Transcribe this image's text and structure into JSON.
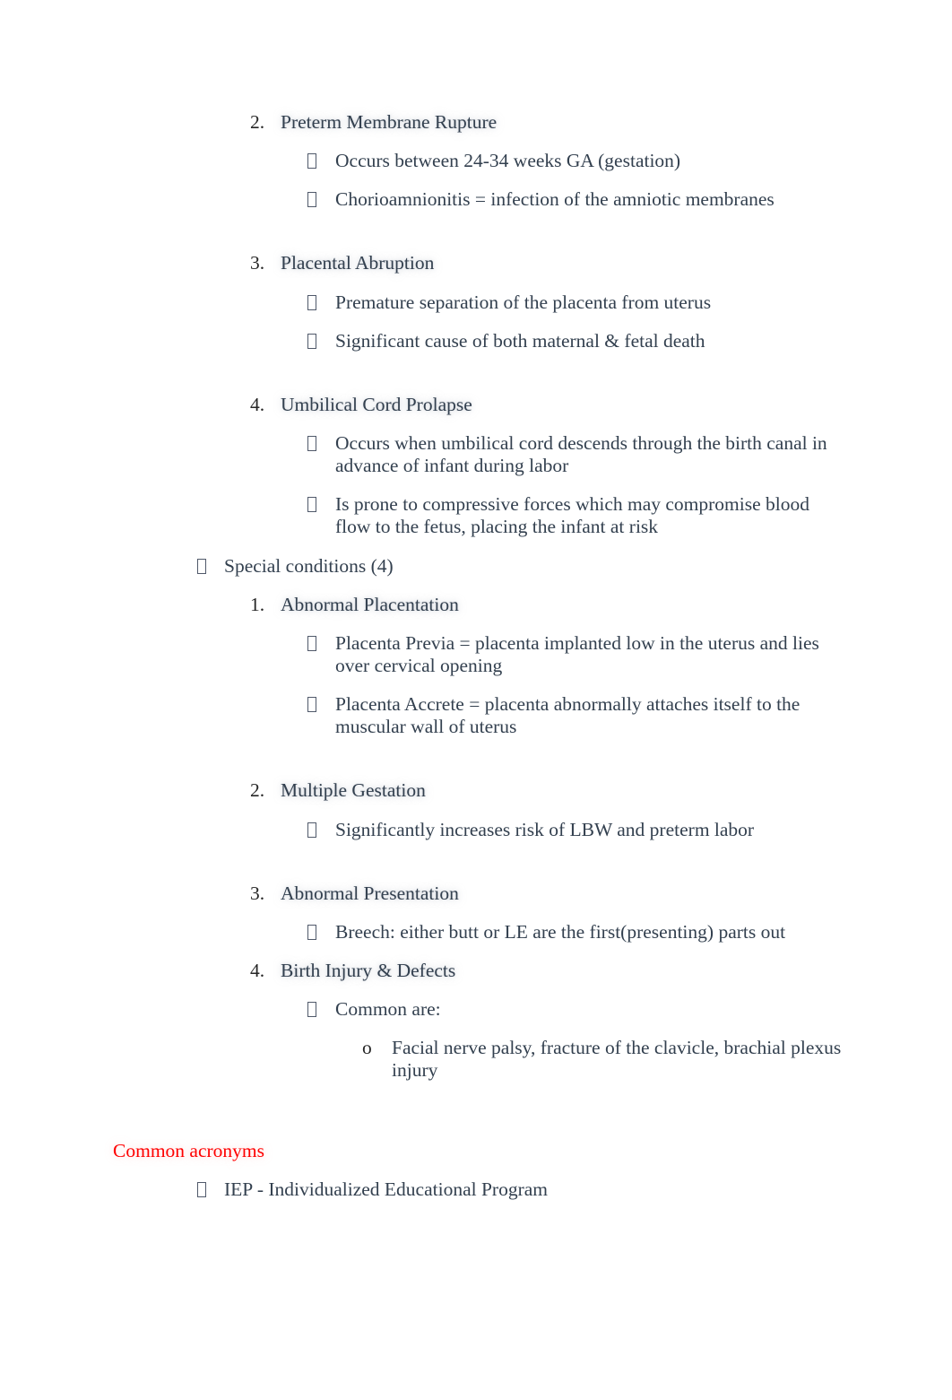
{
  "document": {
    "bullet_glyph": "tofu-box",
    "text_color": "#33404f",
    "marker_color": "#262626",
    "accent_color": "#ff0000",
    "background": "#ffffff"
  },
  "blocks": [
    {
      "id": "preterm-membrane-rupture",
      "level": 2,
      "marker": "2.",
      "text": "Preterm Membrane Rupture",
      "halo": true,
      "children": [
        {
          "id": "pmr-ga",
          "level": 3,
          "marker": "tofu",
          "text": "Occurs between 24-34 weeks GA (gestation)"
        },
        {
          "id": "pmr-chorioamnionitis",
          "level": 3,
          "marker": "tofu",
          "text": "Chorioamnionitis = infection of the amniotic membranes"
        }
      ]
    },
    {
      "id": "placental-abruption",
      "level": 2,
      "marker": "3.",
      "text": "Placental Abruption",
      "halo": true,
      "children": [
        {
          "id": "pa-separation",
          "level": 3,
          "marker": "tofu",
          "text": "Premature separation of the placenta from uterus"
        },
        {
          "id": "pa-death",
          "level": 3,
          "marker": "tofu",
          "text": "Significant cause of both maternal & fetal death"
        }
      ]
    },
    {
      "id": "umbilical-cord-prolapse",
      "level": 2,
      "marker": "4.",
      "text": "Umbilical Cord Prolapse",
      "halo": true,
      "children": [
        {
          "id": "ucp-descends",
          "level": 3,
          "marker": "tofu",
          "text": "Occurs when umbilical cord descends through the birth canal in advance of infant during labor"
        },
        {
          "id": "ucp-compressive",
          "level": 3,
          "marker": "tofu",
          "text": "Is prone to compressive forces which may compromise blood flow to the fetus, placing the infant at risk"
        }
      ]
    },
    {
      "id": "special-conditions",
      "level": 1,
      "marker": "tofu",
      "text": "Special conditions (4)",
      "halo": false,
      "children": [
        {
          "id": "abnormal-placentation",
          "level": 2,
          "marker": "1.",
          "text": "Abnormal Placentation",
          "halo": true,
          "children": [
            {
              "id": "placenta-previa",
              "level": 3,
              "marker": "tofu",
              "text": "Placenta Previa = placenta implanted low in the uterus and lies over cervical opening"
            },
            {
              "id": "placenta-accrete",
              "level": 3,
              "marker": "tofu",
              "text": "Placenta Accrete = placenta abnormally attaches itself to the muscular wall of uterus"
            }
          ]
        },
        {
          "id": "multiple-gestation",
          "level": 2,
          "marker": "2.",
          "text": "Multiple Gestation",
          "halo": true,
          "children": [
            {
              "id": "mg-lbw",
              "level": 3,
              "marker": "tofu",
              "text": "Significantly increases risk of LBW and preterm labor"
            }
          ]
        },
        {
          "id": "abnormal-presentation",
          "level": 2,
          "marker": "3.",
          "text": "Abnormal Presentation",
          "halo": true,
          "children": [
            {
              "id": "breech",
              "level": 3,
              "marker": "tofu",
              "text": "Breech: either butt or LE are the first(presenting) parts out"
            }
          ]
        },
        {
          "id": "birth-injury-defects",
          "level": 2,
          "marker": "4.",
          "text": "Birth Injury & Defects",
          "halo": true,
          "children": [
            {
              "id": "common-are",
              "level": 3,
              "marker": "tofu",
              "text": "Common are:",
              "children": [
                {
                  "id": "injury-list",
                  "level": 4,
                  "marker": "o",
                  "text": "Facial nerve palsy, fracture of the clavicle, brachial plexus injury"
                }
              ]
            }
          ]
        }
      ]
    }
  ],
  "acronyms_section": {
    "title": "Common acronyms",
    "items": [
      {
        "id": "iep",
        "level": 1,
        "marker": "tofu",
        "text": "IEP - Individualized Educational Program"
      }
    ]
  }
}
